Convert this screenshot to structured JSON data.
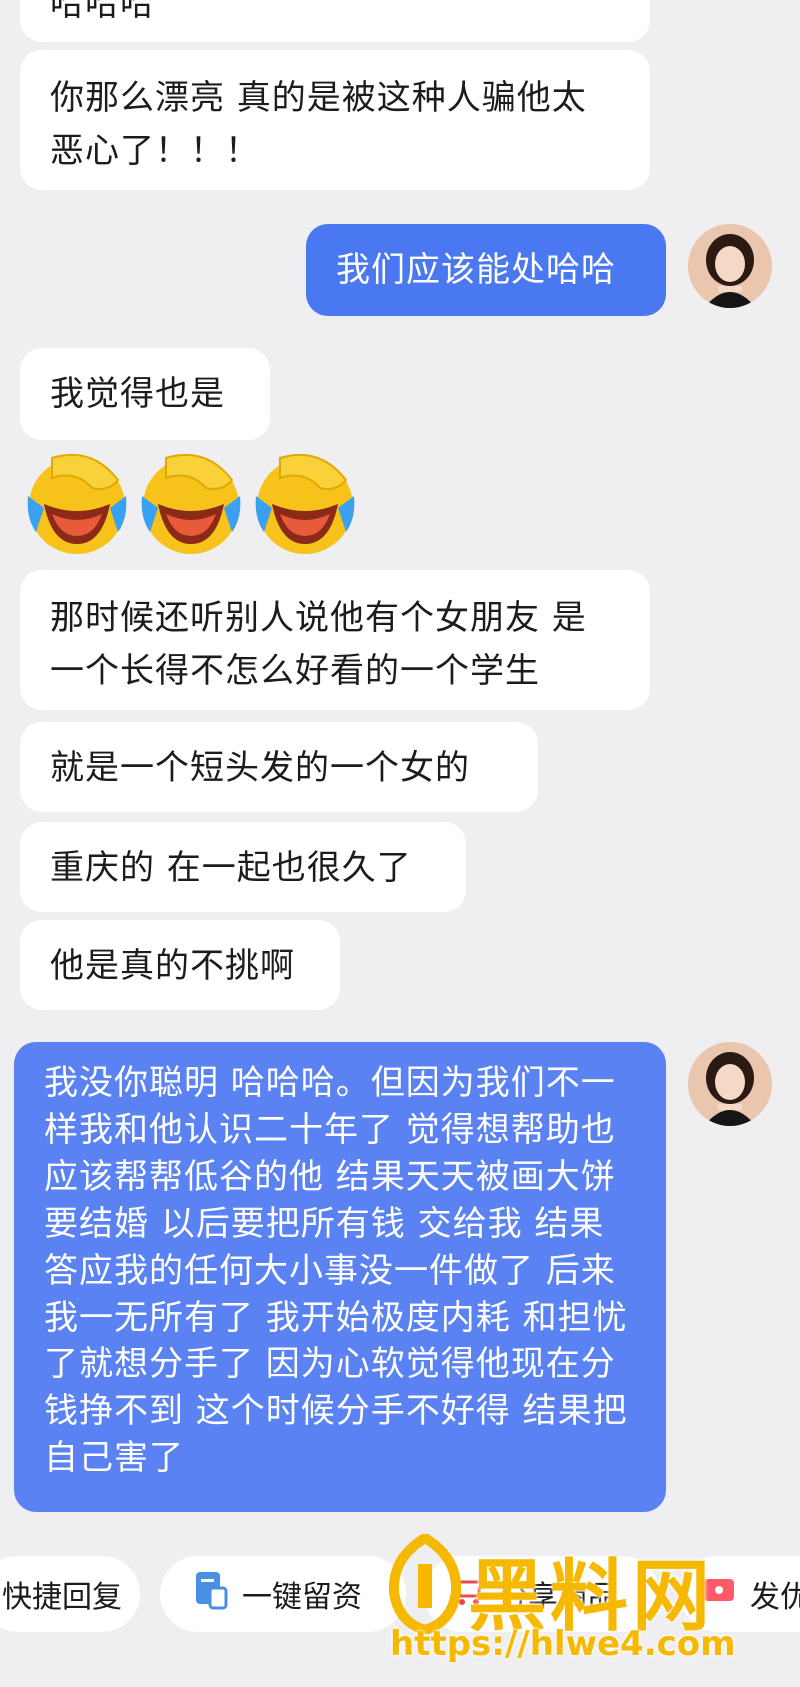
{
  "messages": [
    {
      "side": "left",
      "text": "哈哈哈"
    },
    {
      "side": "left",
      "text": "你那么漂亮 真的是被这种人骗他太恶心了！！！"
    },
    {
      "side": "right",
      "text": "我们应该能处哈哈"
    },
    {
      "side": "left",
      "text": "我觉得也是"
    },
    {
      "side": "left",
      "text": "那时候还听别人说他有个女朋友 是一个长得不怎么好看的一个学生"
    },
    {
      "side": "left",
      "text": "就是一个短头发的一个女的"
    },
    {
      "side": "left",
      "text": "重庆的 在一起也很久了"
    },
    {
      "side": "left",
      "text": "他是真的不挑啊"
    },
    {
      "side": "right",
      "text": "我没你聪明 哈哈哈。但因为我们不一样我和他认识二十年了 觉得想帮助也应该帮帮低谷的他 结果天天被画大饼 要结婚 以后要把所有钱 交给我 结果答应我的任何大小事没一件做了 后来我一无所有了 我开始极度内耗 和担忧了就想分手了 因为心软觉得他现在分钱挣不到 这个时候分手不好得 结果把自己害了"
    }
  ],
  "emoji_row": {
    "count": 3,
    "icon": "facepalm-crying-laugh-emoji"
  },
  "quick_actions": [
    {
      "label": "快捷回复",
      "icon": ""
    },
    {
      "label": "一键留资",
      "icon": "form-icon"
    },
    {
      "label": "分享商品",
      "icon": "cart-icon"
    },
    {
      "label": "发优",
      "icon": "coupon-icon"
    }
  ],
  "watermark": {
    "brand": "黑料网",
    "url": "https://hlwe4.com"
  },
  "colors": {
    "bg": "#efeff1",
    "bubble_right": "#4a78f0",
    "watermark": "#f6b800"
  }
}
